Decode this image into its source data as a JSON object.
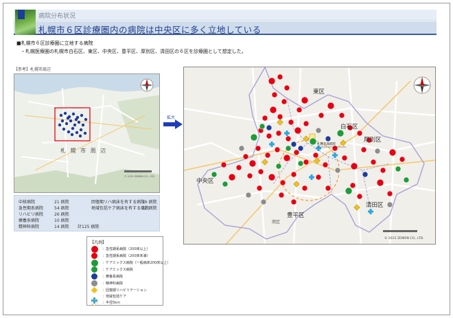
{
  "header": {
    "subtitle": "病院分布状況",
    "title": "札幌市６区診療圏内の病院は中央区に多く立地している"
  },
  "bullets": {
    "heading": "■札幌市６区診療圏に立地する病院",
    "note": "・札幌医療圏の札幌市白石区、東区、中央区、豊平区、厚別区、清田区の６区を診療圏として想定した。"
  },
  "reference": {
    "label": "【参考】札幌市周辺",
    "map_label": "札 幌 市 周 辺",
    "copyright": "© 2015 ZENRIN CO., LTD."
  },
  "arrow": {
    "label": "拡大"
  },
  "main_map": {
    "wards": [
      "東区",
      "白石区",
      "厚別区",
      "中央区",
      "豊平区",
      "清田区",
      "南区"
    ],
    "facility_label": "札幌北海病院",
    "copyright": "© 2015 ZENRIN CO., LTD."
  },
  "hospital_counts": [
    {
      "label": "中核病院",
      "value": "21 病院"
    },
    {
      "label": "急性期系病院",
      "value": "54 病院"
    },
    {
      "label": "リハビリ病院",
      "value": "26 病院"
    },
    {
      "label": "療養系病院",
      "value": "10 病院"
    },
    {
      "label": "精神科病院",
      "value": "14 病院",
      "total": "計125 病院"
    }
  ],
  "ward_counts": [
    {
      "label": "回復期リハ病床を有する病院",
      "value": "16 病院"
    },
    {
      "label": "地域包括ケア病床を有する病院",
      "value": "12 病院"
    }
  ],
  "legend": {
    "title": "【凡例】",
    "items": [
      {
        "label": "：急性期系病院（200床以上）",
        "color": "#e60012",
        "icon": "circle-large"
      },
      {
        "label": "：急性期系病院（200床未満）",
        "color": "#e60012",
        "icon": "circle"
      },
      {
        "label": "：ケアミックス病院（一般病床200床以上）",
        "color": "#1e9b3a",
        "icon": "circle-large"
      },
      {
        "label": "：ケアミックス病院",
        "color": "#1e9b3a",
        "icon": "circle"
      },
      {
        "label": "：療養系病院",
        "color": "#1f3b9b",
        "icon": "circle"
      },
      {
        "label": "：精神科病院",
        "color": "#8c8c8c",
        "icon": "circle"
      },
      {
        "label": "：回復期リハビリテーション",
        "color": "#f0c020",
        "icon": "diamond"
      },
      {
        "label": "：地域包括ケア",
        "color": "#2aa6e0",
        "icon": "cross"
      },
      {
        "label": "：半径5km",
        "color": "#f0a030",
        "icon": "dashed-circle"
      }
    ]
  },
  "colors": {
    "header_blue": "#1f3d8c",
    "acute": "#e60012",
    "caremix": "#1e9b3a",
    "recuperation": "#1f3b9b",
    "psychiatric": "#8c8c8c",
    "rehab": "#f0c020",
    "community_care": "#2aa6e0",
    "radius": "#f0a030"
  }
}
